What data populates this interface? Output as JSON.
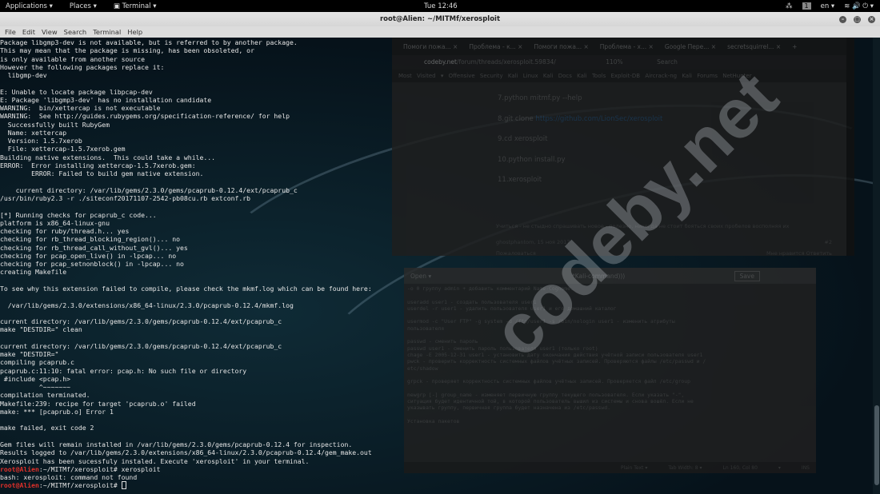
{
  "topbar": {
    "applications": "Applications ▾",
    "places": "Places ▾",
    "terminal": "Terminal ▾",
    "clock": "Tue 12:46",
    "workspace": "1",
    "lang": "en ▾",
    "status_icons": "≋ 🔊 ⏻ ▾"
  },
  "window": {
    "title": "root@Alien: ~/MITMf/xerosploit"
  },
  "menu": [
    "File",
    "Edit",
    "View",
    "Search",
    "Terminal",
    "Help"
  ],
  "browser": {
    "tabs": [
      "Помоги пожа... ×",
      "Проблема - к... ×",
      "Помоги пожа... ×",
      "Проблема - х... ×",
      "Google Пере... ×",
      "secretsquirrel... ×",
      "+"
    ],
    "url_host": "codeby.net",
    "url_path": "/forum/threads/xerosploit.59834/",
    "zoom": "110%",
    "search_placeholder": "Search",
    "bookmarks": "Most Visited ▾  Offensive Security  Kali Linux  Kali Docs  Kali Tools  Exploit-DB  Aircrack-ng  Kali Forums  NetHunter",
    "post": [
      "7.python mitmf.py --help",
      "8.git clone ",
      "9.cd xerosploit",
      "10.python install.py",
      "11.xerosploit"
    ],
    "link": "https://github.com/LionSec/xerosploit",
    "signature": "Учиться - не стыдно спрашивать новое - полезно, никогда не стоит бояться своих пробелов восполняя их",
    "author": "ghostphantom, 15 ноя 2017",
    "post_num": "#2",
    "report": "Пожаловаться",
    "like": "Мне нравится",
    "reply": "Ответить"
  },
  "editor": {
    "open": "Open ▾",
    "title": "*Kali-command)))",
    "save": "Save",
    "text": "-o 0 группу admin + добавить комментарий Name-Cognome.\n\nuseradd user1 - создать пользователя user1\nuserdel -r user1 - удалить пользователя user1 и его домашний каталог\n\nusermod -c \"User FTP\" -g system -d /ftp/user1 -s /bin/nologin user1 - изменить атрибуты\nпользователя\n\npasswd - сменить пароль\npasswd user1 - сменить пароль пользователя user1 (только root)\nchage -E 2005-12-31 user1 - установить дату окончания действия учётной записи пользователя user1\npwck - проверить корректность системных файлов учётных записей. Проверяются файлы /etc/passwd и /\netc/shadow\n\ngrpck - проверяет корректность системных файлов учётных записей. Проверяется файл /etc/group\n\nnewgrp [-] group_name - изменяет первичную группу текущего пользователя. Если указать \"-\",\nситуация будет идентичной той, в которой пользователь вышил из системы и снова вошёл. Если не\nуказывать группу, первичная группа будет назначена из /etc/passwd.\n\nУстановка пакетов",
    "status": [
      "Plain Text ▾",
      "Tab Width: 8 ▾",
      "Ln 160, Col 80",
      "▾",
      "INS"
    ]
  },
  "watermark": "codeby.net",
  "terminal": {
    "lines": [
      "Package libgmp3-dev is not available, but is referred to by another package.",
      "This may mean that the package is missing, has been obsoleted, or",
      "is only available from another source",
      "However the following packages replace it:",
      "  libgmp-dev",
      "",
      "E: Unable to locate package libpcap-dev",
      "E: Package 'libgmp3-dev' has no installation candidate",
      "WARNING:  bin/xettercap is not executable",
      "WARNING:  See http://guides.rubygems.org/specification-reference/ for help",
      "  Successfully built RubyGem",
      "  Name: xettercap",
      "  Version: 1.5.7xerob",
      "  File: xettercap-1.5.7xerob.gem",
      "Building native extensions.  This could take a while...",
      "ERROR:  Error installing xettercap-1.5.7xerob.gem:",
      "        ERROR: Failed to build gem native extension.",
      "",
      "    current directory: /var/lib/gems/2.3.0/gems/pcaprub-0.12.4/ext/pcaprub_c",
      "/usr/bin/ruby2.3 -r ./siteconf20171107-2542-pb08cu.rb extconf.rb",
      "",
      "[*] Running checks for pcaprub_c code...",
      "platform is x86_64-linux-gnu",
      "checking for ruby/thread.h... yes",
      "checking for rb_thread_blocking_region()... no",
      "checking for rb_thread_call_without_gvl()... yes",
      "checking for pcap_open_live() in -lpcap... no",
      "checking for pcap_setnonblock() in -lpcap... no",
      "creating Makefile",
      "",
      "To see why this extension failed to compile, please check the mkmf.log which can be found here:",
      "",
      "  /var/lib/gems/2.3.0/extensions/x86_64-linux/2.3.0/pcaprub-0.12.4/mkmf.log",
      "",
      "current directory: /var/lib/gems/2.3.0/gems/pcaprub-0.12.4/ext/pcaprub_c",
      "make \"DESTDIR=\" clean",
      "",
      "current directory: /var/lib/gems/2.3.0/gems/pcaprub-0.12.4/ext/pcaprub_c",
      "make \"DESTDIR=\"",
      "compiling pcaprub.c",
      "pcaprub.c:11:10: fatal error: pcap.h: No such file or directory",
      " #include <pcap.h>",
      "          ^~~~~~~~",
      "compilation terminated.",
      "Makefile:239: recipe for target 'pcaprub.o' failed",
      "make: *** [pcaprub.o] Error 1",
      "",
      "make failed, exit code 2",
      "",
      "Gem files will remain installed in /var/lib/gems/2.3.0/gems/pcaprub-0.12.4 for inspection.",
      "Results logged to /var/lib/gems/2.3.0/extensions/x86_64-linux/2.3.0/pcaprub-0.12.4/gem_make.out",
      "Xerosploit has been sucessfuly instaled. Execute 'xerosploit' in your terminal.",
      {
        "user": "root@Alien",
        "path": ":~/MITMf/xerosploit# ",
        "cmd": "xerosploit"
      },
      "bash: xerosploit: command not found",
      {
        "user": "root@Alien",
        "path": ":~/MITMf/xerosploit# ",
        "cmd": "",
        "cursor": true
      }
    ]
  },
  "colors": {
    "prompt_user": "#e0302a",
    "terminal_text": "#e6e6e6",
    "terminal_bg": "#07141b"
  }
}
